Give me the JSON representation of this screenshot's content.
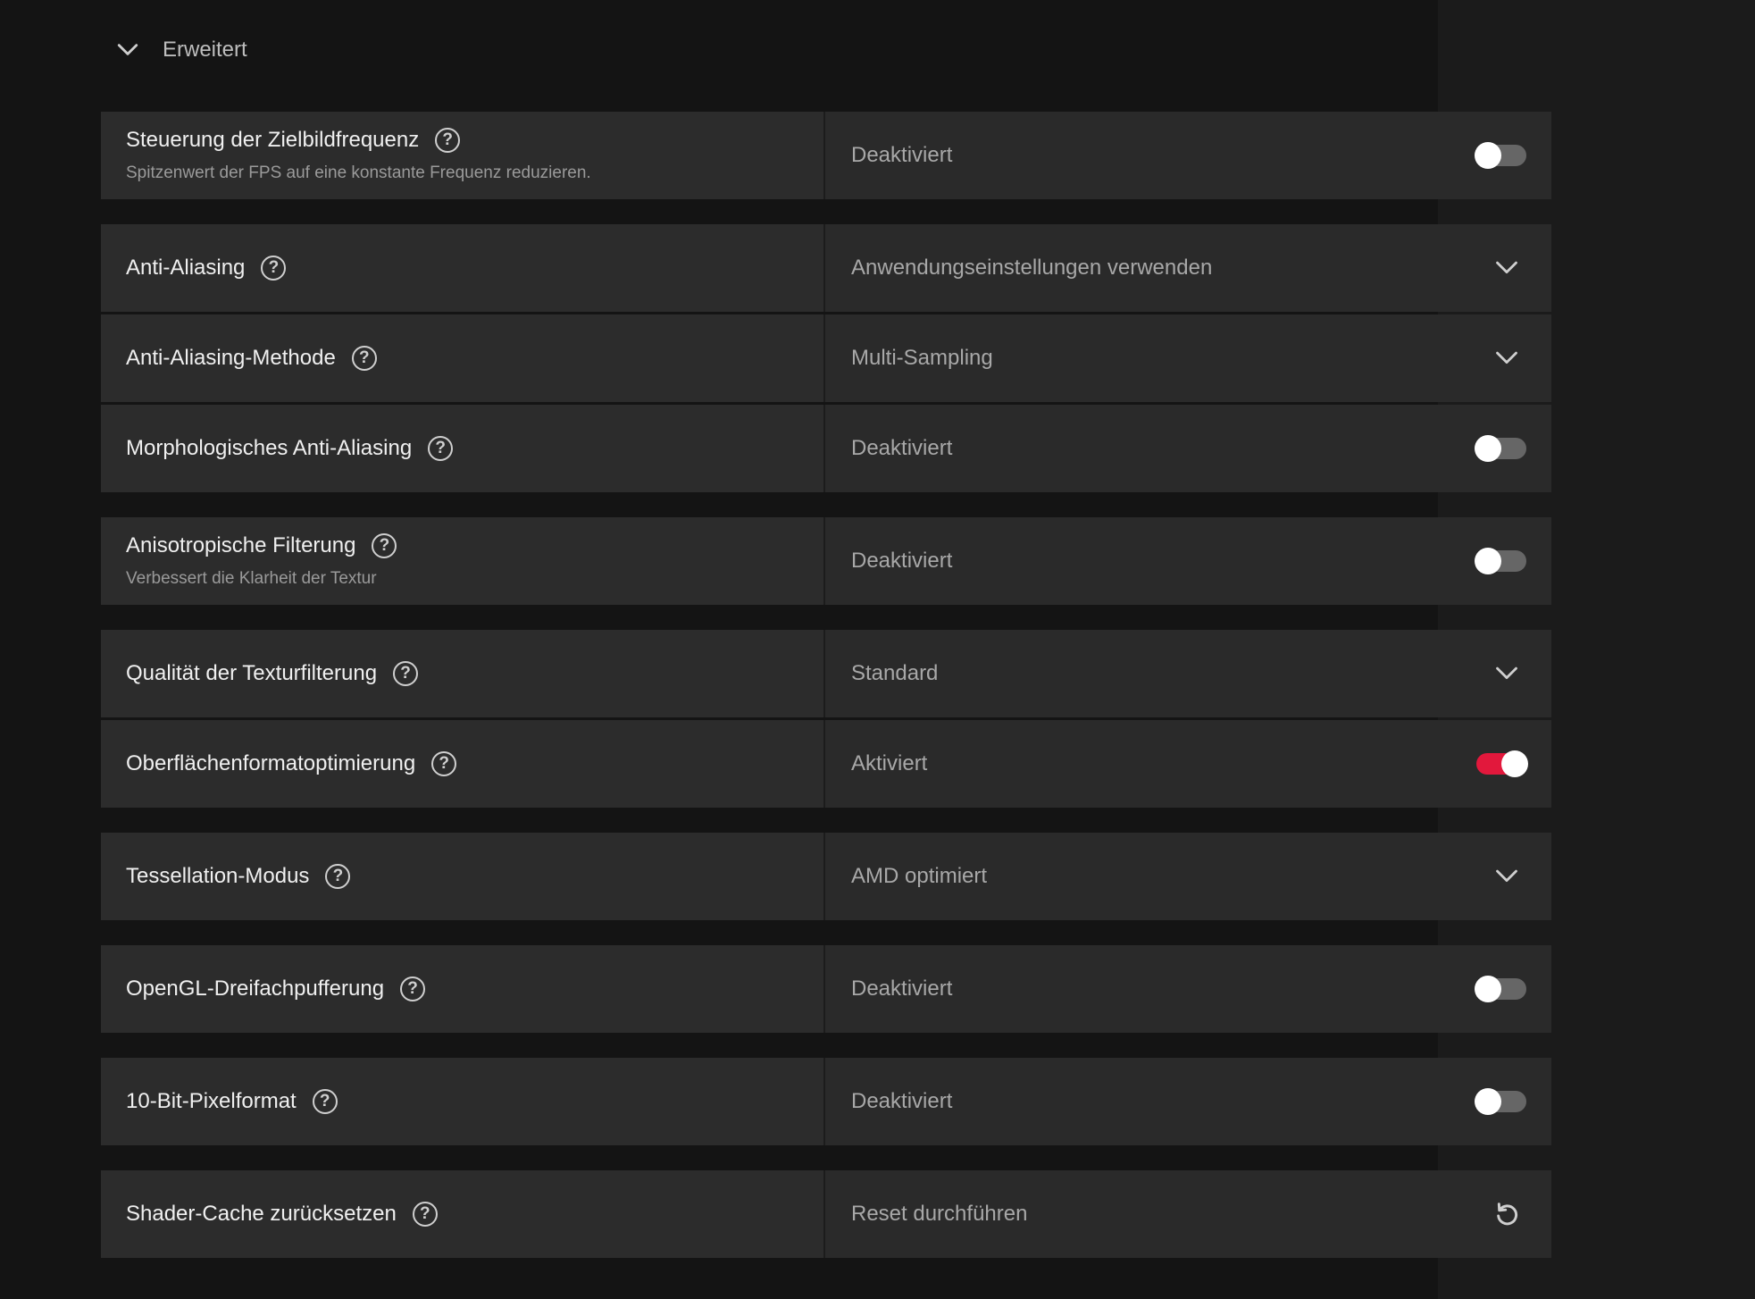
{
  "section": {
    "title": "Erweitert",
    "icon": "chevron-down-icon"
  },
  "rows": [
    {
      "label": "Steuerung der Zielbildfrequenz",
      "description": "Spitzenwert der FPS auf eine konstante Frequenz reduzieren.",
      "value": "Deaktiviert",
      "control": "toggle",
      "on": false
    },
    {
      "label": "Anti-Aliasing",
      "value": "Anwendungseinstellungen verwenden",
      "control": "dropdown"
    },
    {
      "label": "Anti-Aliasing-Methode",
      "value": "Multi-Sampling",
      "control": "dropdown"
    },
    {
      "label": "Morphologisches Anti-Aliasing",
      "value": "Deaktiviert",
      "control": "toggle",
      "on": false
    },
    {
      "label": "Anisotropische Filterung",
      "description": "Verbessert die Klarheit der Textur",
      "value": "Deaktiviert",
      "control": "toggle",
      "on": false
    },
    {
      "label": "Qualität der Texturfilterung",
      "value": "Standard",
      "control": "dropdown"
    },
    {
      "label": "Oberflächenformatoptimierung",
      "value": "Aktiviert",
      "control": "toggle",
      "on": true
    },
    {
      "label": "Tessellation-Modus",
      "value": "AMD optimiert",
      "control": "dropdown"
    },
    {
      "label": "OpenGL-Dreifachpufferung",
      "value": "Deaktiviert",
      "control": "toggle",
      "on": false
    },
    {
      "label": "10-Bit-Pixelformat",
      "value": "Deaktiviert",
      "control": "toggle",
      "on": false
    },
    {
      "label": "Shader-Cache zurücksetzen",
      "value": "Reset durchführen",
      "control": "reset"
    }
  ],
  "help_glyph": "?",
  "colors": {
    "accent": "#e2183c",
    "background": "#141414",
    "row": "#2a2a2a"
  }
}
